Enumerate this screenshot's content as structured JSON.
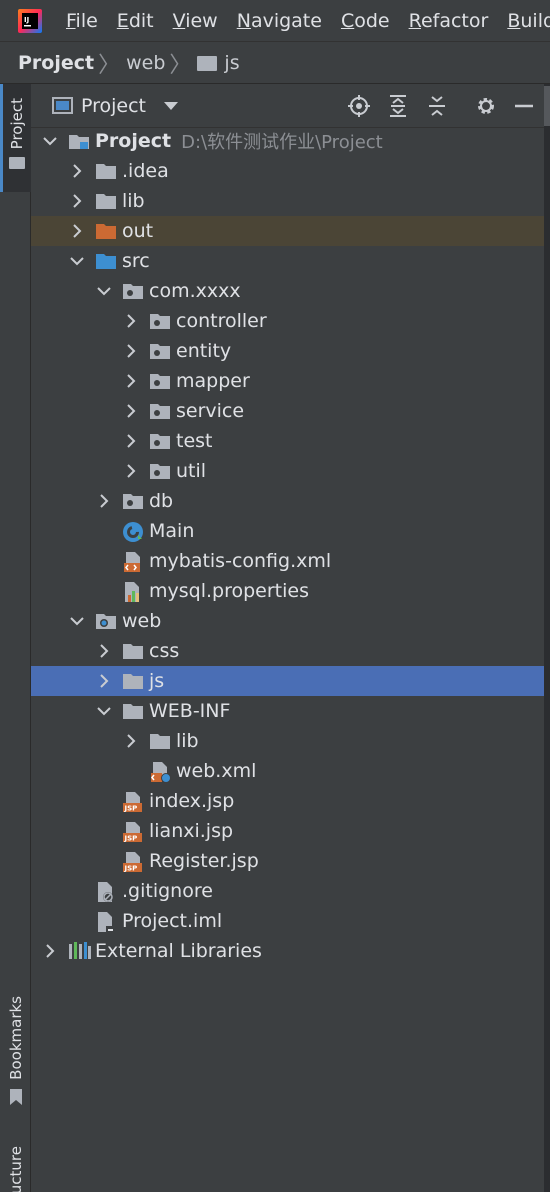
{
  "menubar": {
    "items": [
      {
        "mnemonic": "F",
        "rest": "ile"
      },
      {
        "mnemonic": "E",
        "rest": "dit"
      },
      {
        "mnemonic": "V",
        "rest": "iew"
      },
      {
        "mnemonic": "N",
        "rest": "avigate"
      },
      {
        "mnemonic": "C",
        "rest": "ode"
      },
      {
        "mnemonic": "R",
        "rest": "efactor"
      },
      {
        "mnemonic": "B",
        "rest": "uild"
      }
    ]
  },
  "breadcrumb": [
    "Project",
    "web",
    "js"
  ],
  "leftbar": {
    "project_tab": "Project",
    "bookmarks_tab": "Bookmarks",
    "structure_tab": "Structure"
  },
  "panel": {
    "title": "Project"
  },
  "tree": [
    {
      "label": "Project",
      "path": "D:\\软件测试作业\\Project",
      "level": 0,
      "icon": "project-folder-icon",
      "expanded": true
    },
    {
      "label": ".idea",
      "level": 1,
      "icon": "folder-icon",
      "expanded": false
    },
    {
      "label": "lib",
      "level": 1,
      "icon": "folder-icon",
      "expanded": false
    },
    {
      "label": "out",
      "level": 1,
      "icon": "excluded-folder-icon",
      "expanded": false
    },
    {
      "label": "src",
      "level": 1,
      "icon": "source-folder-icon",
      "expanded": true
    },
    {
      "label": "com.xxxx",
      "level": 2,
      "icon": "package-icon",
      "expanded": true
    },
    {
      "label": "controller",
      "level": 3,
      "icon": "package-icon",
      "expanded": false
    },
    {
      "label": "entity",
      "level": 3,
      "icon": "package-icon",
      "expanded": false
    },
    {
      "label": "mapper",
      "level": 3,
      "icon": "package-icon",
      "expanded": false
    },
    {
      "label": "service",
      "level": 3,
      "icon": "package-icon",
      "expanded": false
    },
    {
      "label": "test",
      "level": 3,
      "icon": "package-icon",
      "expanded": false
    },
    {
      "label": "util",
      "level": 3,
      "icon": "package-icon",
      "expanded": false
    },
    {
      "label": "db",
      "level": 2,
      "icon": "package-icon",
      "expanded": false
    },
    {
      "label": "Main",
      "level": 2,
      "icon": "java-class-icon"
    },
    {
      "label": "mybatis-config.xml",
      "level": 2,
      "icon": "xml-file-icon"
    },
    {
      "label": "mysql.properties",
      "level": 2,
      "icon": "properties-file-icon"
    },
    {
      "label": "web",
      "level": 1,
      "icon": "web-folder-icon",
      "expanded": true
    },
    {
      "label": "css",
      "level": 2,
      "icon": "folder-icon",
      "expanded": false
    },
    {
      "label": "js",
      "level": 2,
      "icon": "folder-icon",
      "expanded": false,
      "selected": true
    },
    {
      "label": "WEB-INF",
      "level": 2,
      "icon": "folder-icon",
      "expanded": true
    },
    {
      "label": "lib",
      "level": 3,
      "icon": "folder-icon",
      "expanded": false
    },
    {
      "label": "web.xml",
      "level": 3,
      "icon": "web-xml-icon"
    },
    {
      "label": "index.jsp",
      "level": 2,
      "icon": "jsp-file-icon"
    },
    {
      "label": "lianxi.jsp",
      "level": 2,
      "icon": "jsp-file-icon"
    },
    {
      "label": "Register.jsp",
      "level": 2,
      "icon": "jsp-file-icon"
    },
    {
      "label": ".gitignore",
      "level": 1,
      "icon": "gitignore-file-icon"
    },
    {
      "label": "Project.iml",
      "level": 1,
      "icon": "iml-file-icon"
    },
    {
      "label": "External Libraries",
      "level": 0,
      "icon": "external-libraries-icon",
      "expanded": false
    }
  ],
  "colors": {
    "selection": "#4a6eb5",
    "excluded_folder": "#cc6a33",
    "source_folder": "#3d8fd1",
    "folder": "#aeb3bb"
  }
}
